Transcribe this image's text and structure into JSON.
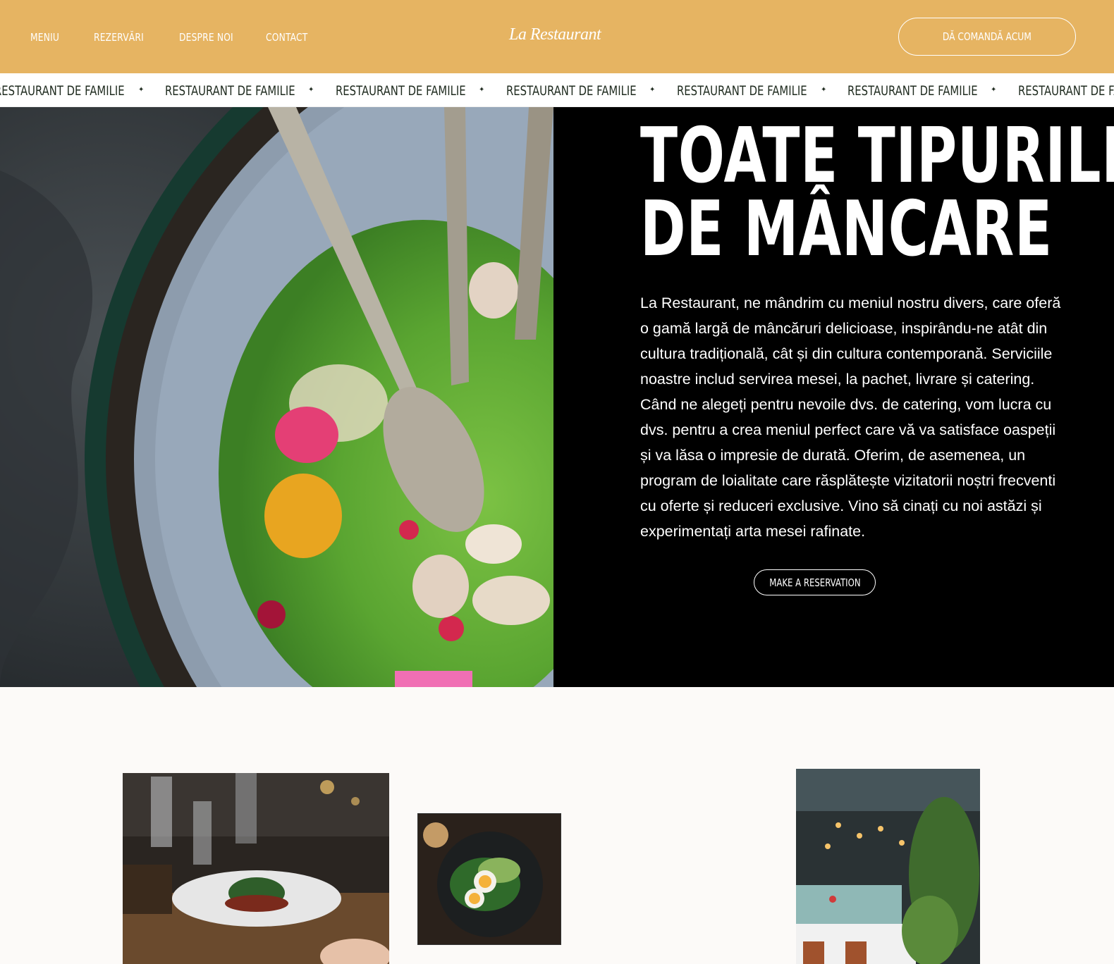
{
  "header": {
    "nav": [
      "MENIU",
      "REZERVĂRI",
      "DESPRE NOI",
      "CONTACT"
    ],
    "brand": "La Restaurant",
    "order_button": "DĂ COMANDĂ ACUM"
  },
  "marquee": {
    "items": [
      "RESTAURANT DE FAMILIE",
      "RESTAURANT DE FAMILIE",
      "RESTAURANT DE FAMILIE",
      "RESTAURANT DE FAMILIE",
      "RESTAURANT DE FAMILIE",
      "RESTAURANT DE FAMILIE",
      "RESTAURANT DE FAMILIE"
    ],
    "separator": "✦"
  },
  "hero": {
    "title_line1": "TOATE TIPURILE",
    "title_line2": "DE MÂNCARE",
    "paragraph": "La Restaurant, ne mândrim cu meniul nostru divers, care oferă o gamă largă de mâncăruri delicioase, inspirându-ne atât din cultura tradițională, cât și din cultura contemporană. Serviciile noastre includ servirea mesei, la pachet, livrare și catering. Când ne alegeți pentru nevoile dvs. de catering, vom lucra cu dvs. pentru a crea meniul perfect care vă va satisface oaspeții și va lăsa o impresie de durată. Oferim, de asemenea, un program de loialitate care răsplătește vizitatorii noștri frecventi cu oferte și reduceri exclusive. Vino să cinați cu noi astăzi și experimentați arta mesei rafinate.",
    "reserve_button": "MAKE A RESERVATION"
  },
  "colors": {
    "header_bg": "#e6b462",
    "hero_bg": "#000000",
    "page_bg": "#fcfaf8"
  }
}
